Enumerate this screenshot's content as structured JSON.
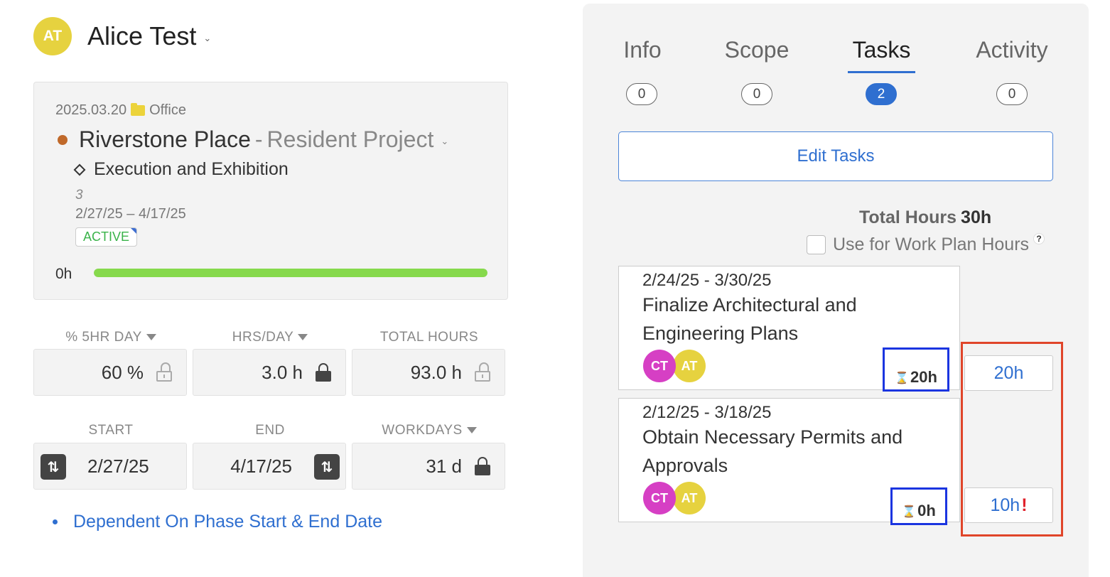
{
  "user": {
    "initials": "AT",
    "name": "Alice Test",
    "avatar_color": "#e6d23f"
  },
  "project": {
    "date": "2025.03.20",
    "folder": "Office",
    "name": "Riverstone Place",
    "separator": "-",
    "subtitle": "Resident Project",
    "dot_color": "#c0692a",
    "phase": "Execution and Exhibition",
    "phase_number": "3",
    "phase_dates": "2/27/25 – 4/17/25",
    "status": "ACTIVE",
    "progress_label": "0h",
    "progress_fraction": 1.0
  },
  "fields": {
    "pct_day": {
      "label": "% 5HR DAY",
      "value": "60 %"
    },
    "hrs_day": {
      "label": "HRS/DAY",
      "value": "3.0 h"
    },
    "total_hours": {
      "label": "TOTAL HOURS",
      "value": "93.0 h"
    },
    "start": {
      "label": "START",
      "value": "2/27/25"
    },
    "end": {
      "label": "END",
      "value": "4/17/25"
    },
    "workdays": {
      "label": "WORKDAYS",
      "value": "31 d"
    }
  },
  "dependency_link": "Dependent On Phase Start & End Date",
  "tabs": [
    {
      "label": "Info",
      "count": "0"
    },
    {
      "label": "Scope",
      "count": "0"
    },
    {
      "label": "Tasks",
      "count": "2"
    },
    {
      "label": "Activity",
      "count": "0"
    }
  ],
  "edit_tasks_label": "Edit Tasks",
  "total_hours_label": "Total Hours",
  "total_hours_value": "30h",
  "work_plan_label": "Use for Work Plan Hours",
  "help_glyph": "?",
  "tasks": [
    {
      "dates": "2/24/25 - 3/30/25",
      "title": "Finalize Architectural and Engineering Plans",
      "assignees": [
        {
          "initials": "CT",
          "color": "#d63fc4"
        },
        {
          "initials": "AT",
          "color": "#e6d23f"
        }
      ],
      "estimate": "20h",
      "hours": "20h"
    },
    {
      "dates": "2/12/25 - 3/18/25",
      "title": "Obtain Necessary Permits and Approvals",
      "assignees": [
        {
          "initials": "CT",
          "color": "#d63fc4"
        },
        {
          "initials": "AT",
          "color": "#e6d23f"
        }
      ],
      "estimate": "0h",
      "hours": "10h",
      "hours_warning": "!"
    }
  ],
  "colors": {
    "accent": "#2f6fd0",
    "active_green": "#3ab34a",
    "progress": "#86d94c",
    "highlight_blue": "#1b35e0",
    "highlight_red": "#e0452a"
  }
}
